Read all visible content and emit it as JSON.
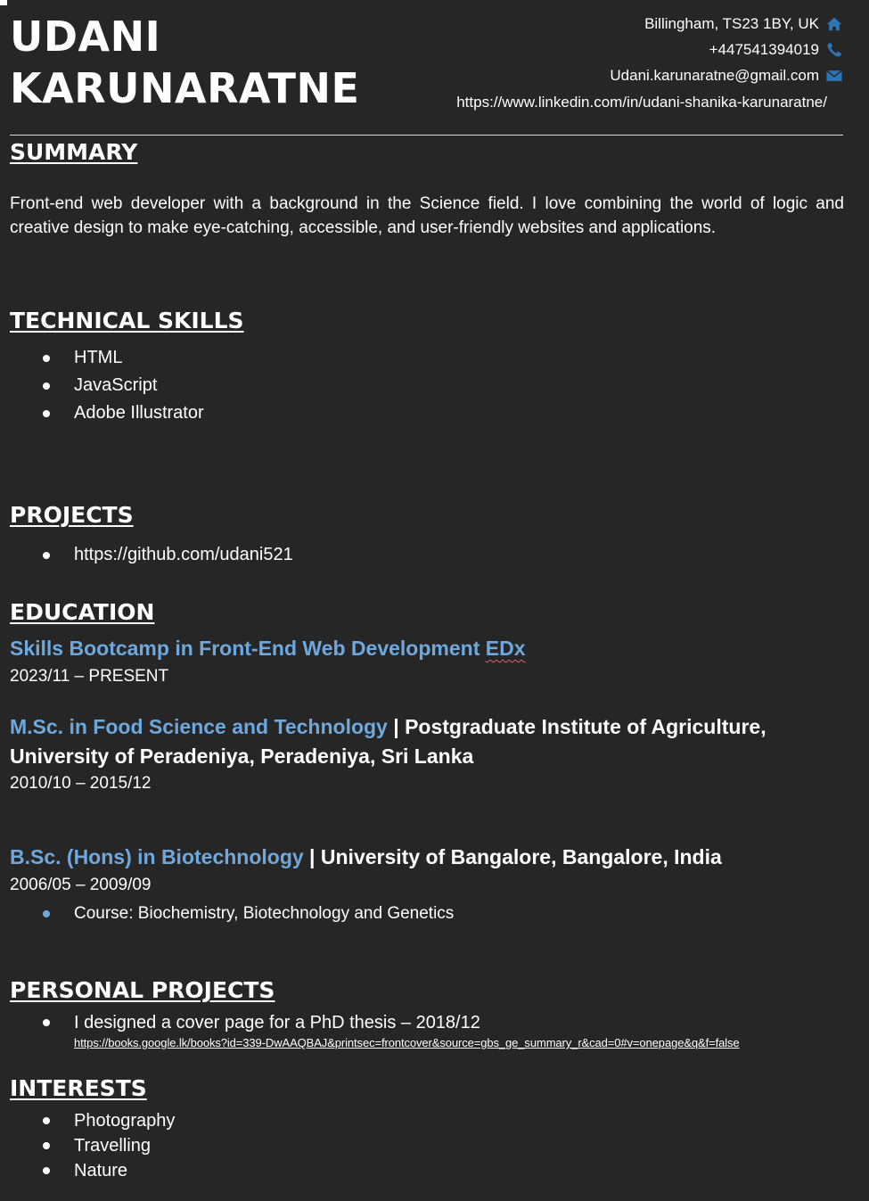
{
  "header": {
    "first_name": "UDANI",
    "last_name": "KARUNARATNE",
    "contact": {
      "location": "Billingham, TS23 1BY, UK",
      "phone": "+447541394019",
      "email": "Udani.karunaratne@gmail.com",
      "linkedin": "https://www.linkedin.com/in/udani-shanika-karunaratne/",
      "icon_location": "home-icon",
      "icon_phone": "phone-icon",
      "icon_email": "envelope-icon"
    }
  },
  "summary": {
    "title": "SUMMARY",
    "text": "Front-end web developer with a background in the Science field. I love combining the world of logic and creative design to make eye-catching, accessible, and user-friendly websites and applications."
  },
  "technical_skills": {
    "title": "TECHNICAL SKILLS",
    "items": [
      "HTML",
      "JavaScript",
      "Adobe Illustrator"
    ]
  },
  "projects": {
    "title": "PROJECTS",
    "items": [
      "https://github.com/udani521"
    ]
  },
  "education": {
    "title": "EDUCATION",
    "entries": [
      {
        "degree": "Skills Bootcamp in Front-End Web Development ",
        "provider": "EDx",
        "dates": "2023/11 – PRESENT"
      },
      {
        "degree": "M.Sc. in Food Science and Technology",
        "separator": " | ",
        "institution_line1": "Postgraduate Institute of Agriculture,",
        "institution_line2": "University of Peradeniya, Peradeniya, Sri Lanka",
        "dates": "2010/10 – 2015/12"
      },
      {
        "degree": "B.Sc. (Hons) in Biotechnology",
        "separator": " | ",
        "institution": "University of Bangalore, Bangalore, India",
        "dates": "2006/05 – 2009/09",
        "course": "Course: Biochemistry, Biotechnology and Genetics"
      }
    ]
  },
  "personal_projects": {
    "title": "PERSONAL PROJECTS",
    "item": "I designed a cover page for a PhD thesis – 2018/12",
    "link": "https://books.google.lk/books?id=339-DwAAQBAJ&printsec=frontcover&source=gbs_ge_summary_r&cad=0#v=onepage&q&f=false"
  },
  "interests": {
    "title": "INTERESTS",
    "items": [
      "Photography",
      "Travelling",
      "Nature"
    ]
  },
  "colors": {
    "background": "#262626",
    "text": "#ffffff",
    "accent_blue": "#6fa8dc",
    "icon_blue": "#2e75b6"
  }
}
